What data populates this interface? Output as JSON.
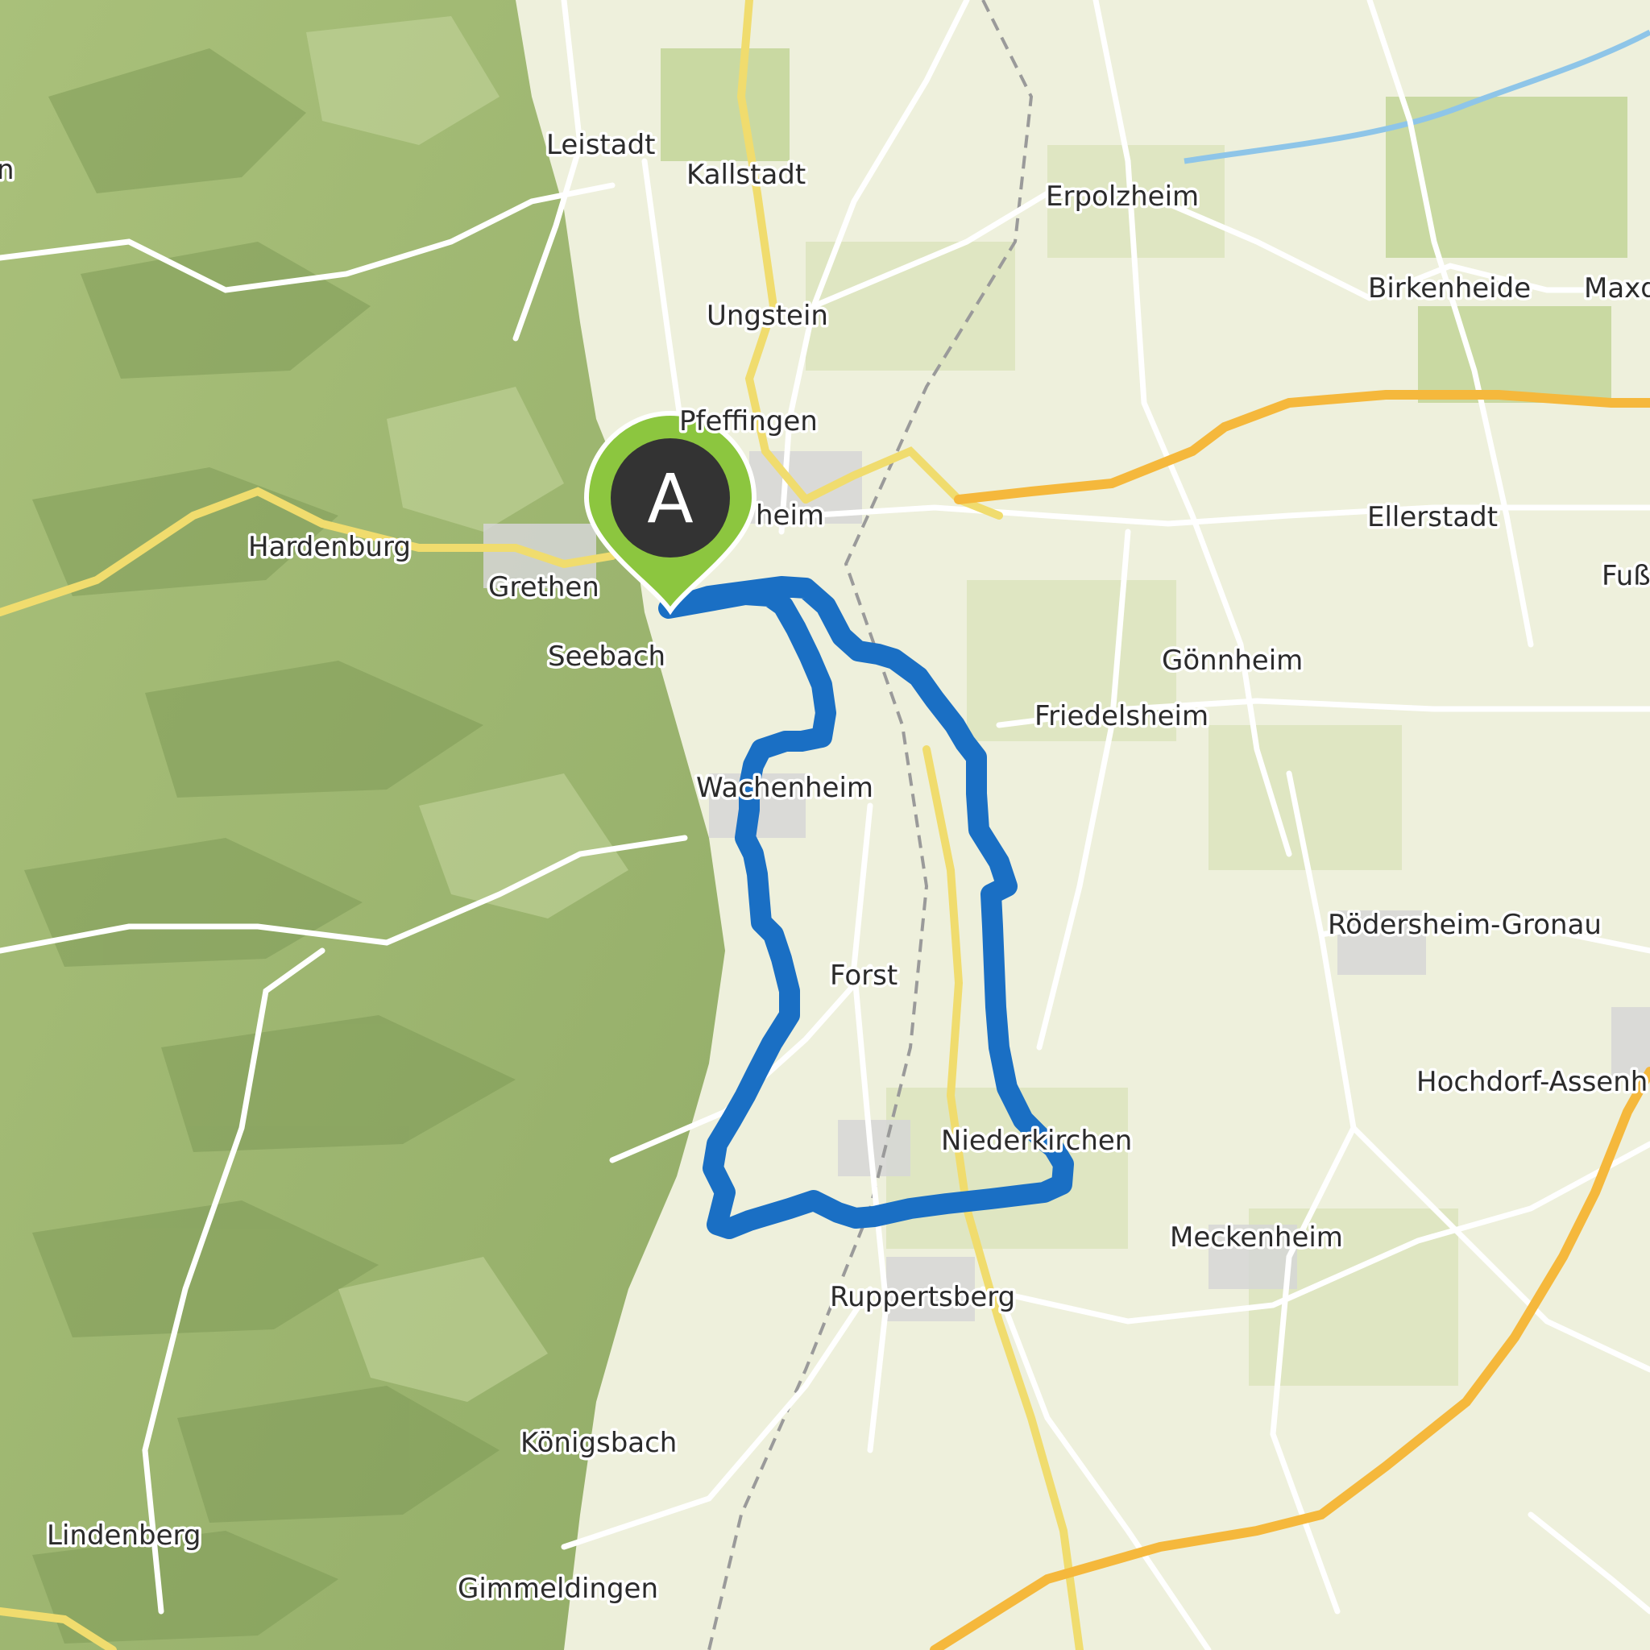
{
  "map": {
    "colors": {
      "route": "#1a6fc4",
      "marker_fill": "#8cc63f",
      "marker_inner": "#333333",
      "highway": "#f5b83c",
      "main_road": "#f0dc6e"
    },
    "start_marker": {
      "label": "A",
      "icon": "map-pin-icon"
    },
    "places": [
      {
        "id": "leistadt",
        "name": "Leistadt"
      },
      {
        "id": "kallstadt",
        "name": "Kallstadt"
      },
      {
        "id": "erpolzheim",
        "name": "Erpolzheim"
      },
      {
        "id": "ungstein",
        "name": "Ungstein"
      },
      {
        "id": "birkenheide",
        "name": "Birkenheide"
      },
      {
        "id": "maxdorf",
        "name": "Maxd"
      },
      {
        "id": "pfeffingen",
        "name": "Pfeffingen"
      },
      {
        "id": "bad-duerkheim",
        "name": "heim"
      },
      {
        "id": "hardenburg",
        "name": "Hardenburg"
      },
      {
        "id": "grethen",
        "name": "Grethen"
      },
      {
        "id": "ellerstadt",
        "name": "Ellerstadt"
      },
      {
        "id": "fussgoenheim",
        "name": "Fuß"
      },
      {
        "id": "seebach",
        "name": "Seebach"
      },
      {
        "id": "goennheim",
        "name": "Gönnheim"
      },
      {
        "id": "friedelsheim",
        "name": "Friedelsheim"
      },
      {
        "id": "wachenheim",
        "name": "Wachenheim"
      },
      {
        "id": "roedersheim-gronau",
        "name": "Rödersheim-Gronau"
      },
      {
        "id": "forst",
        "name": "Forst"
      },
      {
        "id": "hochdorf-assenheim",
        "name": "Hochdorf-Assenh"
      },
      {
        "id": "niederkirchen",
        "name": "Niederkirchen"
      },
      {
        "id": "meckenheim",
        "name": "Meckenheim"
      },
      {
        "id": "ruppertsberg",
        "name": "Ruppertsberg"
      },
      {
        "id": "koenigsbach",
        "name": "Königsbach"
      },
      {
        "id": "lindenberg",
        "name": "Lindenberg"
      },
      {
        "id": "gimmeldingen",
        "name": "Gimmeldingen"
      },
      {
        "id": "edge-left",
        "name": "n"
      }
    ]
  }
}
